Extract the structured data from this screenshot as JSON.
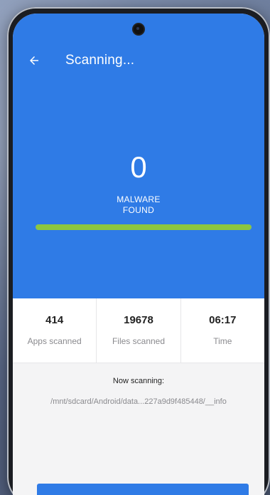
{
  "appbar": {
    "title": "Scanning...",
    "back_icon": "arrow-left-icon"
  },
  "result": {
    "count": "0",
    "label_line1": "MALWARE",
    "label_line2": "FOUND"
  },
  "progress": {
    "value": 1.0,
    "color": "#8cc63f"
  },
  "stats": [
    {
      "value": "414",
      "label": "Apps scanned"
    },
    {
      "value": "19678",
      "label": "Files scanned"
    },
    {
      "value": "06:17",
      "label": "Time"
    }
  ],
  "scanning": {
    "heading": "Now scanning:",
    "path": "/mnt/sdcard/Android/data...227a9d9f485448/__info"
  },
  "colors": {
    "primary": "#2f7be6",
    "accent": "#8cc63f"
  }
}
